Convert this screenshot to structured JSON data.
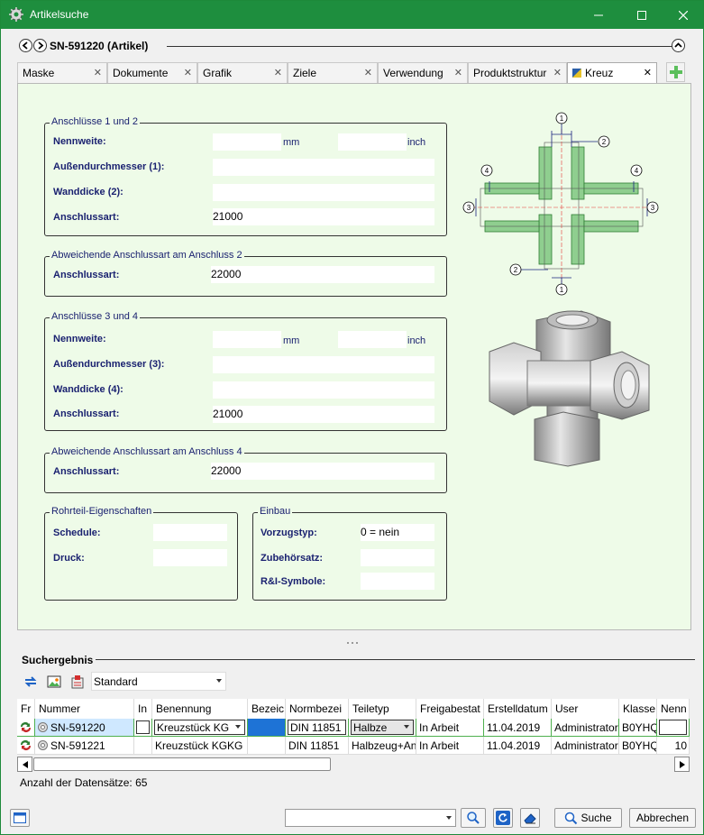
{
  "window": {
    "title": "Artikelsuche"
  },
  "header": {
    "title": "SN-591220 (Artikel)"
  },
  "tabs": [
    {
      "label": "Maske"
    },
    {
      "label": "Dokumente"
    },
    {
      "label": "Grafik"
    },
    {
      "label": "Ziele"
    },
    {
      "label": "Verwendung"
    },
    {
      "label": "Produktstruktur"
    },
    {
      "label": "Kreuz"
    }
  ],
  "form": {
    "g1": {
      "title": "Anschlüsse 1 und 2",
      "nennweite_label": "Nennweite:",
      "unit_mm": "mm",
      "unit_inch": "inch",
      "aussen_label": "Außendurchmesser (1):",
      "wand_label": "Wanddicke (2):",
      "art_label": "Anschlussart:",
      "art_value": "21000"
    },
    "g2": {
      "title": "Abweichende Anschlussart am Anschluss 2",
      "art_label": "Anschlussart:",
      "art_value": "22000"
    },
    "g3": {
      "title": "Anschlüsse 3 und 4",
      "nennweite_label": "Nennweite:",
      "unit_mm": "mm",
      "unit_inch": "inch",
      "aussen_label": "Außendurchmesser (3):",
      "wand_label": "Wanddicke (4):",
      "art_label": "Anschlussart:",
      "art_value": "21000"
    },
    "g4": {
      "title": "Abweichende Anschlussart am Anschluss 4",
      "art_label": "Anschlussart:",
      "art_value": "22000"
    },
    "rohr": {
      "title": "Rohrteil-Eigenschaften",
      "schedule_label": "Schedule:",
      "druck_label": "Druck:"
    },
    "einbau": {
      "title": "Einbau",
      "vorzug_label": "Vorzugstyp:",
      "vorzug_value": "0 = nein",
      "zubehoer_label": "Zubehörsatz:",
      "ri_label": "R&I-Symbole:"
    }
  },
  "diagram": {
    "marks": [
      "1",
      "2",
      "3",
      "4"
    ]
  },
  "results": {
    "title": "Suchergebnis",
    "view_selected": "Standard",
    "columns": [
      "Fr",
      "Nummer",
      "In",
      "Benennung",
      "Bezeic",
      "Normbezei",
      "Teiletyp",
      "Freigabestat",
      "Erstelldatum",
      "User",
      "Klasse",
      "Nenn"
    ],
    "rows": [
      {
        "nummer": "SN-591220",
        "in": "",
        "benennung": "Kreuzstück KG",
        "bezeichnung": "",
        "norm": "DIN 11851",
        "teiletyp": "Halbze",
        "freigabe": "In Arbeit",
        "datum": "11.04.2019",
        "user": "Administrator",
        "klasse": "B0YHQ",
        "nenn": ""
      },
      {
        "nummer": "SN-591221",
        "in": "",
        "benennung": "Kreuzstück KGKG",
        "bezeichnung": "",
        "norm": "DIN 11851",
        "teiletyp": "Halbzeug+An",
        "freigabe": "In Arbeit",
        "datum": "11.04.2019",
        "user": "Administrator",
        "klasse": "B0YHQ",
        "nenn": "10"
      }
    ],
    "count_label": "Anzahl der Datensätze: 65"
  },
  "bottom": {
    "search_label": "Suche",
    "cancel_label": "Abbrechen"
  },
  "colors": {
    "titlebar": "#1e8e3e",
    "panel": "#eefbe8",
    "label": "#1a2170",
    "row_selected": "#cfe8ff"
  }
}
